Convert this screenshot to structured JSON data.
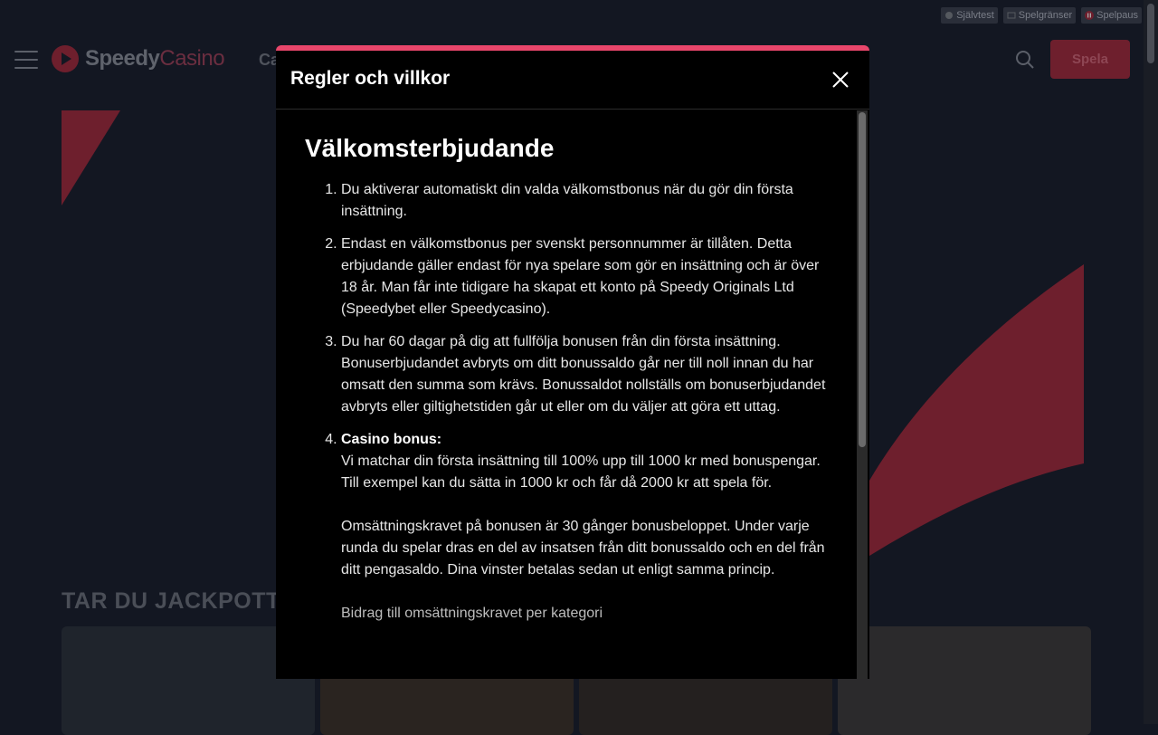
{
  "topbar": {
    "chips": [
      {
        "label": "Självtest",
        "icon": "self-test-icon"
      },
      {
        "label": "Spelgränser",
        "icon": "limits-icon"
      },
      {
        "label": "Spelpaus",
        "icon": "pause-icon"
      }
    ]
  },
  "header": {
    "logo_part1": "Speedy",
    "logo_part2": "Casino",
    "nav_peek": "Ca",
    "play_label": "Spela"
  },
  "section": {
    "title": "TAR DU JACKPOTTEN"
  },
  "modal": {
    "title": "Regler och villkor",
    "heading": "Välkomsterbjudande",
    "items": [
      {
        "text": "Du aktiverar automatiskt din valda välkomstbonus när du gör din första insättning."
      },
      {
        "text": "Endast en välkomstbonus per svenskt personnummer är tillåten. Detta erbjudande gäller endast för nya spelare som gör en insättning och är över 18 år. Man får inte tidigare ha skapat ett konto på Speedy Originals Ltd (Speedybet eller Speedycasino)."
      },
      {
        "text": "Du har 60 dagar på dig att fullfölja bonusen från din första insättning. Bonuserbjudandet avbryts om ditt bonussaldo går ner till noll innan du har omsatt den summa som krävs. Bonussaldot nollställs om bonuserbjudandet avbryts eller giltighetstiden går ut eller om du väljer att göra ett uttag."
      },
      {
        "title": "Casino bonus:",
        "para1": "Vi matchar din första insättning till 100% upp till 1000 kr med bonuspengar. Till exempel kan du sätta in 1000 kr och får då 2000 kr att spela för.",
        "para2": "Omsättningskravet på bonusen är 30 gånger bonusbeloppet. Under varje runda du spelar dras en del av insatsen från ditt bonussaldo och en del från ditt pengasaldo. Dina vinster betalas sedan ut enligt samma princip.",
        "para3": "Bidrag till omsättningskravet per kategori"
      }
    ]
  },
  "colors": {
    "accent": "#e8466b",
    "background": "#131722",
    "modal_bg": "#000000"
  }
}
